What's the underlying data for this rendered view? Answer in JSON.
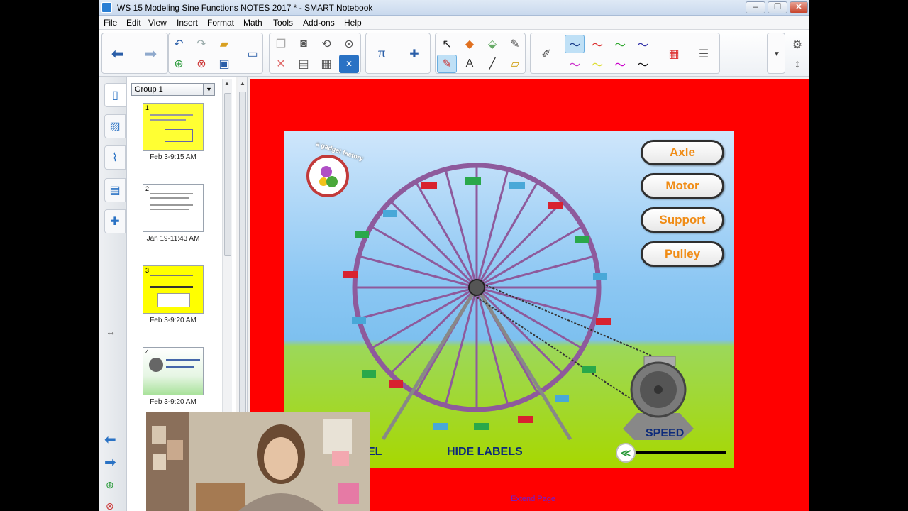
{
  "window": {
    "title": "WS 15 Modeling Sine Functions NOTES 2017 * - SMART Notebook",
    "controls": {
      "minimize": "–",
      "maximize": "❐",
      "close": "✕"
    }
  },
  "menu": [
    "File",
    "Edit",
    "View",
    "Insert",
    "Format",
    "Math",
    "Tools",
    "Add-ons",
    "Help"
  ],
  "sorter": {
    "group": "Group 1",
    "pages": [
      {
        "num": "1",
        "label": "Feb 3-9:15 AM",
        "color": "#ffff33"
      },
      {
        "num": "2",
        "label": "Jan 19-11:43 AM",
        "color": "#ffffff"
      },
      {
        "num": "3",
        "label": "Feb 3-9:20 AM",
        "color": "#ffff00"
      },
      {
        "num": "4",
        "label": "Feb 3-9:20 AM",
        "color": "#dff5dd"
      }
    ]
  },
  "flash": {
    "logo_text": "a gadget factory",
    "buttons": [
      "Axle",
      "Motor",
      "Support",
      "Pulley"
    ],
    "model_label": "EL",
    "hide_labels": "HIDE LABELS",
    "speed_label": "SPEED",
    "slider_symbol": "≪"
  },
  "extend_page": "Extend Page",
  "colors": {
    "page_bg": "#ff0000",
    "button_text": "#f08c16",
    "label_text": "#0c2a7a",
    "wheel": "#8e5a9c"
  }
}
